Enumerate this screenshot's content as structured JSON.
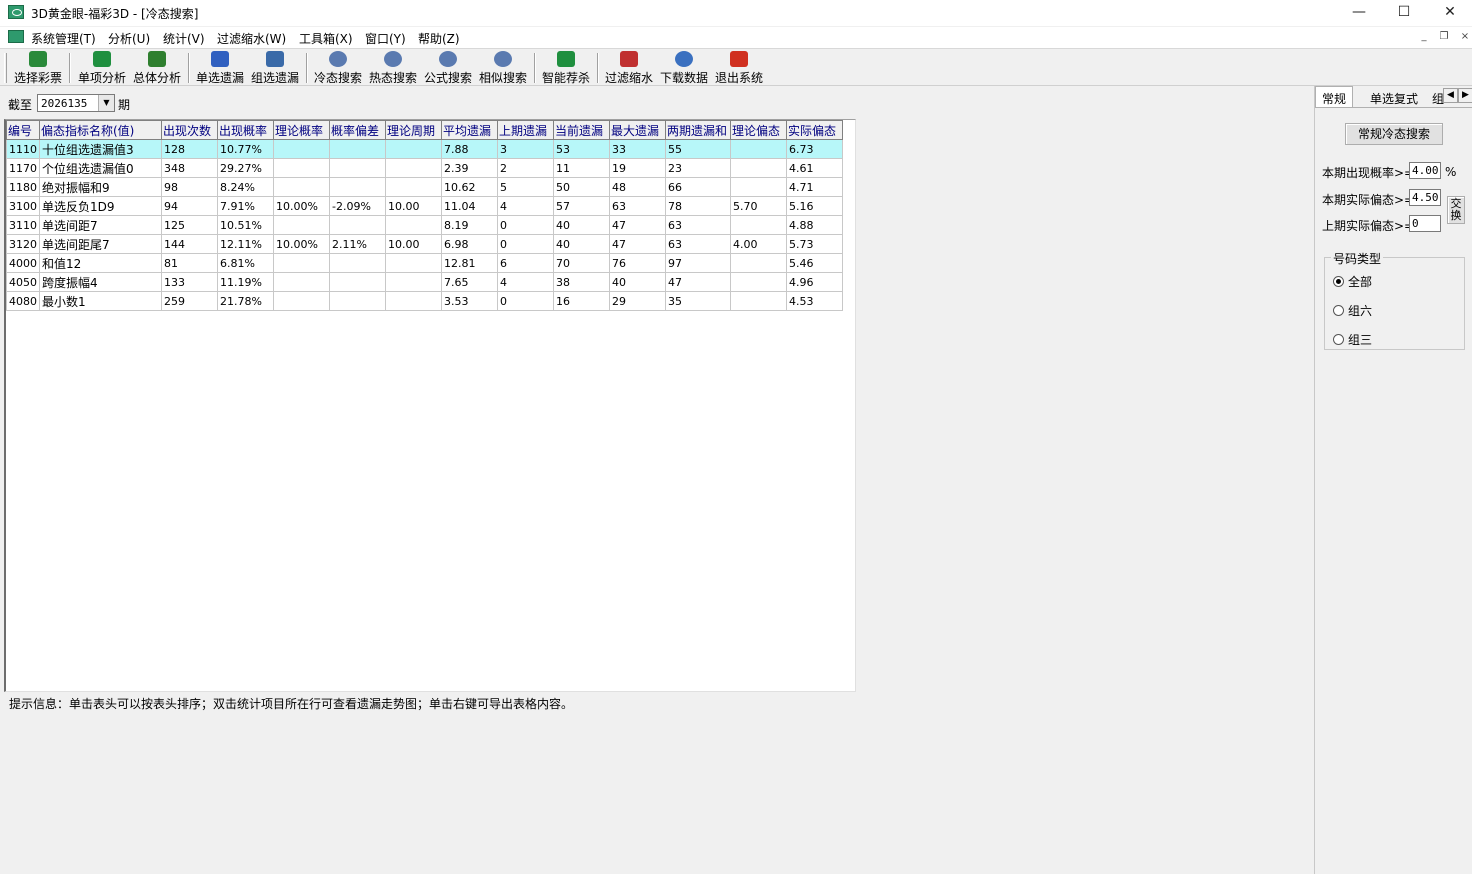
{
  "window": {
    "title": "3D黄金眼-福彩3D - [冷态搜索]",
    "minimize": "—",
    "maximize": "☐",
    "close": "✕"
  },
  "menu": {
    "items": [
      "系统管理(T)",
      "分析(U)",
      "统计(V)",
      "过滤缩水(W)",
      "工具箱(X)",
      "窗口(Y)",
      "帮助(Z)"
    ],
    "mdi_min": "_",
    "mdi_restore": "❐",
    "mdi_close": "×"
  },
  "toolbar": {
    "buttons": [
      {
        "label": "选择彩票",
        "icon": "select-lottery-icon",
        "color": "#2a8a3a"
      },
      {
        "label": "单项分析",
        "icon": "single-analysis-icon",
        "color": "#1f8f3f"
      },
      {
        "label": "总体分析",
        "icon": "overall-analysis-icon",
        "color": "#2f7f2f"
      },
      {
        "label": "单选遗漏",
        "icon": "single-omission-icon",
        "color": "#3060c0"
      },
      {
        "label": "组选遗漏",
        "icon": "group-omission-icon",
        "color": "#3a6aa8"
      },
      {
        "label": "冷态搜索",
        "icon": "cold-search-icon",
        "color": "#5a7ab0"
      },
      {
        "label": "热态搜索",
        "icon": "hot-search-icon",
        "color": "#5a7ab0"
      },
      {
        "label": "公式搜索",
        "icon": "formula-search-icon",
        "color": "#5a7ab0"
      },
      {
        "label": "相似搜索",
        "icon": "similar-search-icon",
        "color": "#5a7ab0"
      },
      {
        "label": "智能荐杀",
        "icon": "smart-recommend-icon",
        "color": "#1f8f3f"
      },
      {
        "label": "过滤缩水",
        "icon": "filter-shrink-icon",
        "color": "#c03030"
      },
      {
        "label": "下载数据",
        "icon": "download-data-icon",
        "color": "#3a70c0"
      },
      {
        "label": "退出系统",
        "icon": "exit-system-icon",
        "color": "#d03020"
      }
    ]
  },
  "filter": {
    "cutoff_label": "截至",
    "period_value": "2026135",
    "period_suffix": "期"
  },
  "grid": {
    "columns": [
      "编号",
      "偏态指标名称(值)",
      "出现次数",
      "出现概率",
      "理论概率",
      "概率偏差",
      "理论周期",
      "平均遗漏",
      "上期遗漏",
      "当前遗漏",
      "最大遗漏",
      "两期遗漏和",
      "理论偏态",
      "实际偏态"
    ],
    "rows": [
      [
        "1110",
        "十位组选遗漏值3",
        "128",
        "10.77%",
        "",
        "",
        "",
        "7.88",
        "3",
        "53",
        "33",
        "55",
        "",
        "6.73"
      ],
      [
        "1170",
        "个位组选遗漏值0",
        "348",
        "29.27%",
        "",
        "",
        "",
        "2.39",
        "2",
        "11",
        "19",
        "23",
        "",
        "4.61"
      ],
      [
        "1180",
        "绝对振幅和9",
        "98",
        "8.24%",
        "",
        "",
        "",
        "10.62",
        "5",
        "50",
        "48",
        "66",
        "",
        "4.71"
      ],
      [
        "3100",
        "单选反负1D9",
        "94",
        "7.91%",
        "10.00%",
        "-2.09%",
        "10.00",
        "11.04",
        "4",
        "57",
        "63",
        "78",
        "5.70",
        "5.16"
      ],
      [
        "3110",
        "单选间距7",
        "125",
        "10.51%",
        "",
        "",
        "",
        "8.19",
        "0",
        "40",
        "47",
        "63",
        "",
        "4.88"
      ],
      [
        "3120",
        "单选间距尾7",
        "144",
        "12.11%",
        "10.00%",
        "2.11%",
        "10.00",
        "6.98",
        "0",
        "40",
        "47",
        "63",
        "4.00",
        "5.73"
      ],
      [
        "4000",
        "和值12",
        "81",
        "6.81%",
        "",
        "",
        "",
        "12.81",
        "6",
        "70",
        "76",
        "97",
        "",
        "5.46"
      ],
      [
        "4050",
        "跨度振幅4",
        "133",
        "11.19%",
        "",
        "",
        "",
        "7.65",
        "4",
        "38",
        "40",
        "47",
        "",
        "4.96"
      ],
      [
        "4080",
        "最小数1",
        "259",
        "21.78%",
        "",
        "",
        "",
        "3.53",
        "0",
        "16",
        "29",
        "35",
        "",
        "4.53"
      ]
    ]
  },
  "hint": "提示信息：单击表头可以按表头排序；双击统计项目所在行可查看遗漏走势图；单击右键可导出表格内容。",
  "panel": {
    "tabs": [
      "常规",
      "单选复式",
      "组"
    ],
    "search_button": "常规冷态搜索",
    "prob_label": "本期出现概率>=",
    "prob_value": "4.00",
    "prob_unit": "%",
    "cur_skew_label": "本期实际偏态>=",
    "cur_skew_value": "4.50",
    "prev_skew_label": "上期实际偏态>=",
    "prev_skew_value": "0",
    "swap_button": "交换",
    "group_title": "号码类型",
    "radios": [
      "全部",
      "组六",
      "组三"
    ],
    "selected_radio": "全部"
  },
  "colors": {
    "selected_row": "#b7f7f9",
    "header_text": "#000080"
  }
}
